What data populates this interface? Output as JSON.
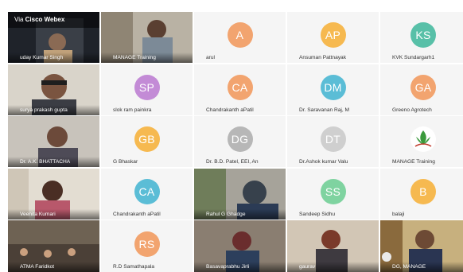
{
  "banner": {
    "prefix": "Via ",
    "brand": "Cisco Webex"
  },
  "tiles": [
    {
      "type": "video",
      "name": "uday Kumar Singh"
    },
    {
      "type": "video",
      "name": "MANAGE Training"
    },
    {
      "type": "avatar",
      "initials": "A",
      "name": "arul",
      "color": "#f2a46f"
    },
    {
      "type": "avatar",
      "initials": "AP",
      "name": "Ansuman Pattnayak",
      "color": "#f6b950"
    },
    {
      "type": "avatar",
      "initials": "KS",
      "name": "KVK Sundargarh1",
      "color": "#58c0a8"
    },
    {
      "type": "video",
      "name": "surya prakash gupta"
    },
    {
      "type": "avatar",
      "initials": "SP",
      "name": "slok ram painkra",
      "color": "#c38bd6"
    },
    {
      "type": "avatar",
      "initials": "CA",
      "name": "Chandrakanth aPatil",
      "color": "#f2a46f"
    },
    {
      "type": "avatar",
      "initials": "DM",
      "name": "Dr. Saravanan Raj, M",
      "color": "#5bbdd6"
    },
    {
      "type": "avatar",
      "initials": "GA",
      "name": "Greeno Agrotech",
      "color": "#f2a46f"
    },
    {
      "type": "video",
      "name": "Dr. A.K. BHATTACHA"
    },
    {
      "type": "avatar",
      "initials": "GB",
      "name": "G Bhaskar",
      "color": "#f6b950"
    },
    {
      "type": "avatar",
      "initials": "DG",
      "name": "Dr. B.D. Patel, EEI, An",
      "color": "#b7b7b7"
    },
    {
      "type": "avatar",
      "initials": "DT",
      "name": "Dr.Ashok kumar Valu",
      "color": "#cfcfcf"
    },
    {
      "type": "logo",
      "name": "MANAGE Training"
    },
    {
      "type": "video",
      "name": "Veenita Kumari"
    },
    {
      "type": "avatar",
      "initials": "CA",
      "name": "Chandrakanth aPatil",
      "color": "#5bbdd6"
    },
    {
      "type": "video",
      "name": "Rahul G Ghadge"
    },
    {
      "type": "avatar",
      "initials": "SS",
      "name": "Sandeep Sidhu",
      "color": "#7fd3a0"
    },
    {
      "type": "avatar",
      "initials": "B",
      "name": "balaji",
      "color": "#f6b950"
    },
    {
      "type": "video",
      "name": "ATMA Faridkot"
    },
    {
      "type": "avatar",
      "initials": "RS",
      "name": "R.D Samathapala",
      "color": "#f2a46f"
    },
    {
      "type": "video",
      "name": "Basavaprabhu Jirli"
    },
    {
      "type": "video",
      "name": "gaurav"
    },
    {
      "type": "video",
      "name": "DG, MANAGE"
    }
  ]
}
